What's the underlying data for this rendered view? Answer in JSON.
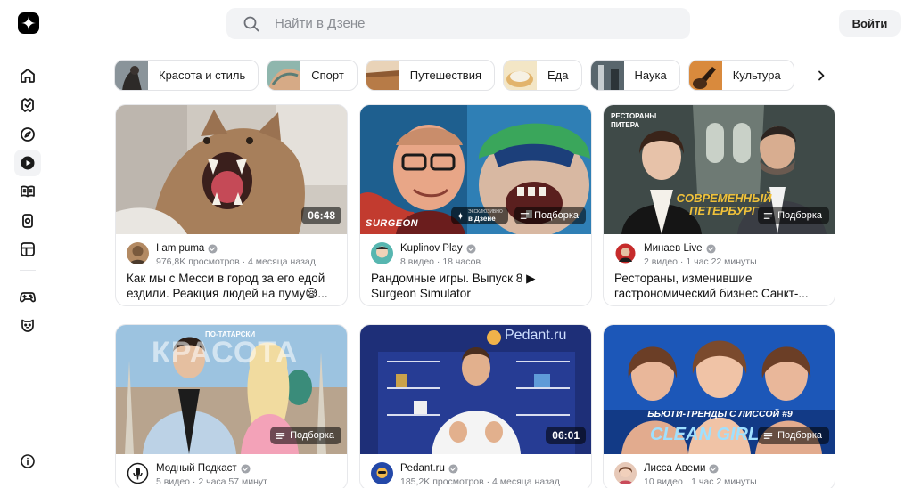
{
  "header": {
    "search_placeholder": "Найти в Дзене",
    "login_label": "Войти"
  },
  "sidebar": {
    "items": [
      {
        "icon": "home-icon"
      },
      {
        "icon": "subscriptions-icon"
      },
      {
        "icon": "compass-icon"
      },
      {
        "icon": "video-play-icon",
        "active": true
      },
      {
        "icon": "book-icon"
      },
      {
        "icon": "shorts-icon"
      },
      {
        "icon": "news-icon"
      },
      {
        "icon": "gamepad-icon"
      },
      {
        "icon": "kids-bear-icon"
      },
      {
        "icon": "info-icon"
      }
    ]
  },
  "categories": [
    {
      "label": "Красота и стиль",
      "color": "#6f7a83"
    },
    {
      "label": "Спорт",
      "color": "#7fa8a0"
    },
    {
      "label": "Путешествия",
      "color": "#c89a6a"
    },
    {
      "label": "Еда",
      "color": "#e7c98f"
    },
    {
      "label": "Наука",
      "color": "#4f5d66"
    },
    {
      "label": "Культура",
      "color": "#a6612a"
    }
  ],
  "cards": [
    {
      "channel": "I am puma",
      "stats": "976,8K просмотров · 4 месяца назад",
      "title_line1": "Как мы с Месси в город за его едой",
      "title_line2": "ездили. Реакция людей на пуму😪...",
      "badge": "06:48",
      "badge_type": "duration"
    },
    {
      "channel": "Kuplinov Play",
      "stats": "8 видео · 18 часов",
      "title_line1": "Рандомные игры. Выпуск 8 ▶",
      "title_line2": "Surgeon Simulator",
      "badge": "Подборка",
      "badge_type": "collection",
      "exclusive_line1": "эксклюзивно",
      "exclusive_line2": "в Дзене",
      "overlay": "SURGEON"
    },
    {
      "channel": "Минаев Live",
      "stats": "2 видео · 1 час 22 минуты",
      "title_line1": "Рестораны, изменившие",
      "title_line2": "гастрономический бизнес Санкт-...",
      "badge": "Подборка",
      "badge_type": "collection",
      "overlay_small": "РЕСТОРАНЫ ПИТЕРА",
      "overlay": "СОВРЕМЕННЫЙ ПЕТЕРБУРГ"
    },
    {
      "channel": "Модный Подкаст",
      "stats": "5 видео · 2 часа 57 минут",
      "badge": "Подборка",
      "badge_type": "collection",
      "overlay_small": "ПО-ТАТАРСКИ",
      "overlay": "КРАСОТА"
    },
    {
      "channel": "Pedant.ru",
      "stats": "185,2K просмотров · 4 месяца назад",
      "badge": "06:01",
      "badge_type": "duration",
      "overlay": "Pedant.ru"
    },
    {
      "channel": "Лисса Авеми",
      "stats": "10 видео · 1 час 2 минуты",
      "badge": "Подборка",
      "badge_type": "collection",
      "overlay_small": "БЬЮТИ-ТРЕНДЫ С ЛИССОЙ #9",
      "overlay": "CLEAN GIRL"
    }
  ]
}
